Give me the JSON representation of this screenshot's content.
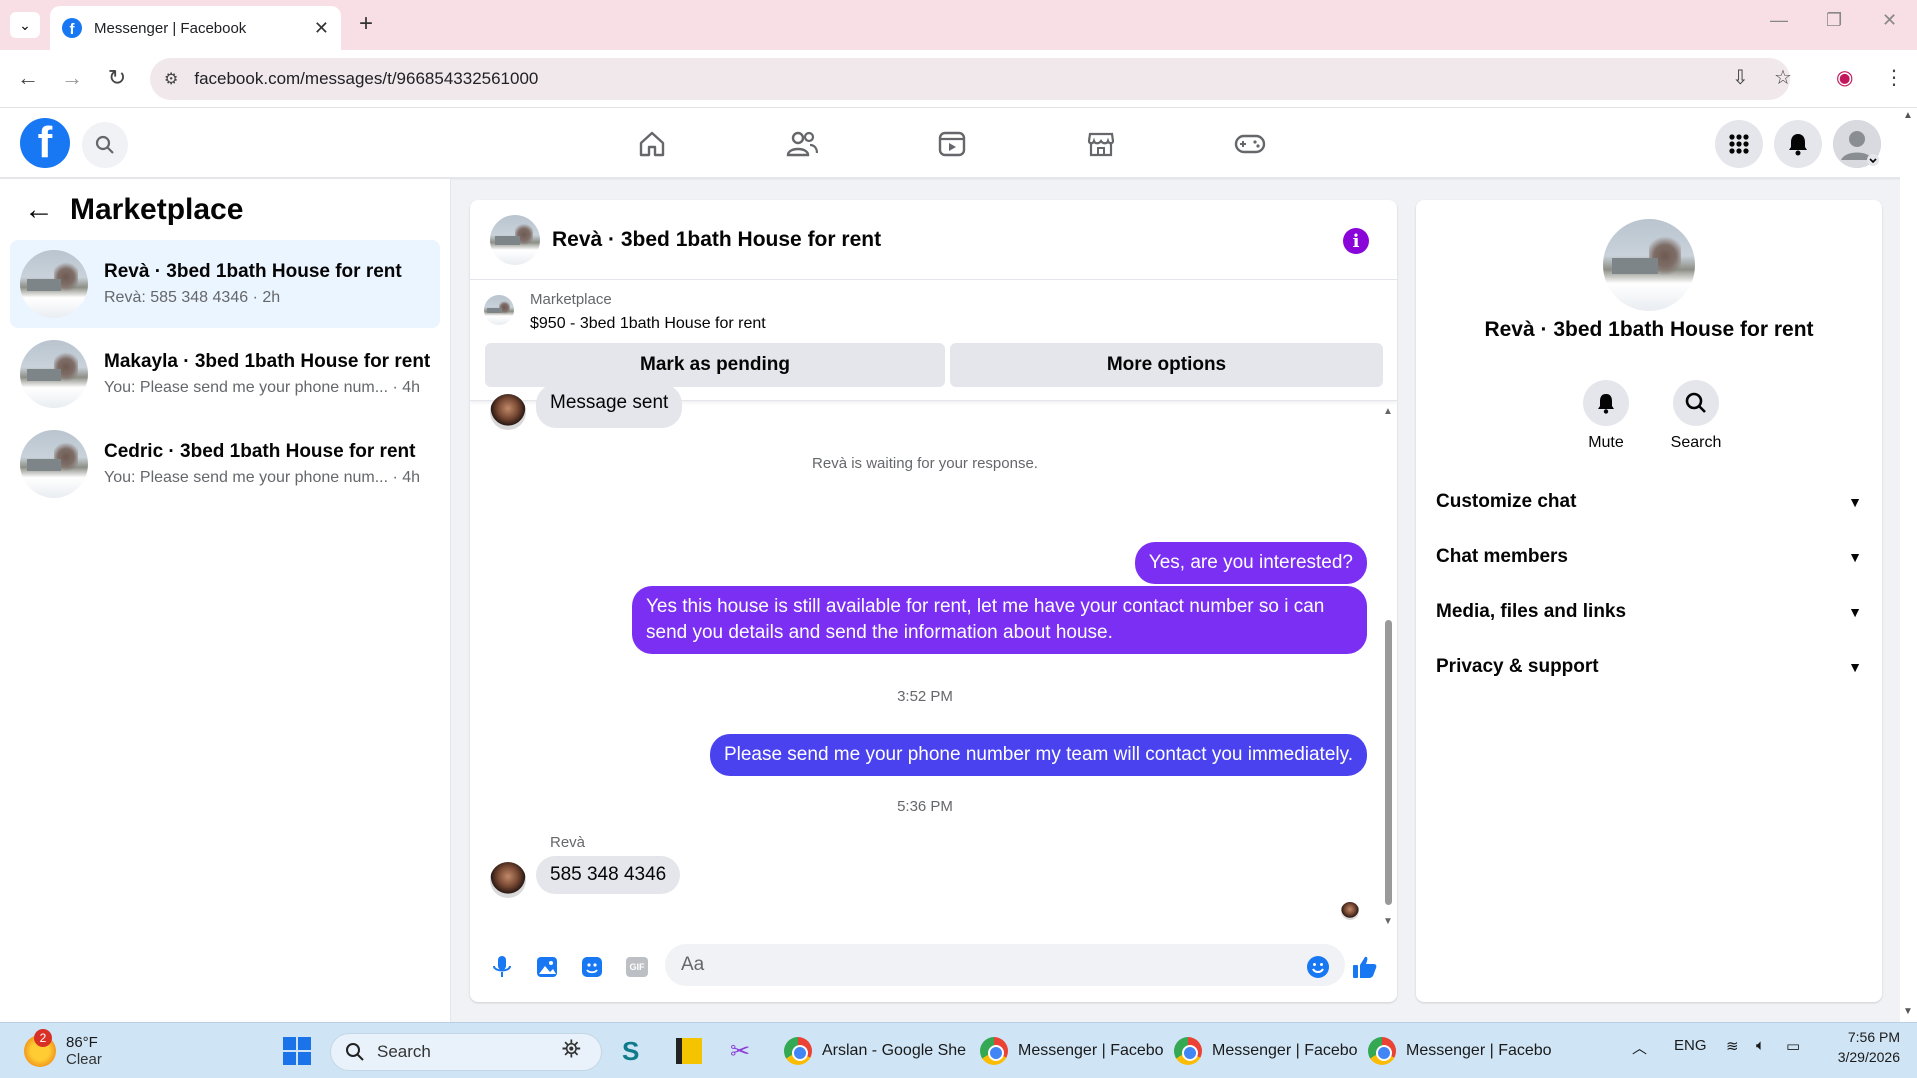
{
  "browser": {
    "tab_title": "Messenger | Facebook",
    "url": "facebook.com/messages/t/966854332561000"
  },
  "sidebar": {
    "title": "Marketplace",
    "conversations": [
      {
        "name": "Revà · 3bed 1bath House for rent",
        "preview": "Revà: 585 348 4346 · 2h"
      },
      {
        "name": "Makayla · 3bed 1bath House for rent",
        "preview": "You: Please send me your phone num... · 4h"
      },
      {
        "name": "Cedric · 3bed 1bath House for rent",
        "preview": "You: Please send me your phone num... · 4h"
      }
    ]
  },
  "chat": {
    "title": "Revà · 3bed 1bath House for rent",
    "marketplace_label": "Marketplace",
    "listing": "$950 - 3bed 1bath House for rent",
    "mark_pending": "Mark as pending",
    "more_options": "More options",
    "partial_msg": "Message sent",
    "waiting_note": "Revà is waiting for your response.",
    "messages": {
      "m1": "Yes, are you interested?",
      "m2": "Yes this house is still available for rent, let me have your contact number so i can send you details and send the information about house.",
      "time1": "3:52 PM",
      "m3": "Please send me your phone number my team will contact you immediately.",
      "time2": "5:36 PM",
      "sender": "Revà",
      "m4": "585 348 4346"
    },
    "composer_placeholder": "Aa",
    "gif_label": "GIF"
  },
  "details": {
    "name": "Revà · 3bed 1bath House for rent",
    "mute": "Mute",
    "search": "Search",
    "sections": [
      "Customize chat",
      "Chat members",
      "Media, files and links",
      "Privacy & support"
    ]
  },
  "taskbar": {
    "weather_temp": "86°F",
    "weather_cond": "Clear",
    "weather_badge": "2",
    "search": "Search",
    "apps": [
      "Arslan - Google She",
      "Messenger | Facebo",
      "Messenger | Facebo",
      "Messenger | Facebo"
    ],
    "lang": "ENG",
    "time": "7:56 PM",
    "date": "3/29/2026"
  },
  "colors": {
    "fb_blue": "#1877f2",
    "purple_bubble": "#7b2ff2",
    "blue_bubble": "#4a42ee",
    "info_purple": "#8a05d8"
  }
}
